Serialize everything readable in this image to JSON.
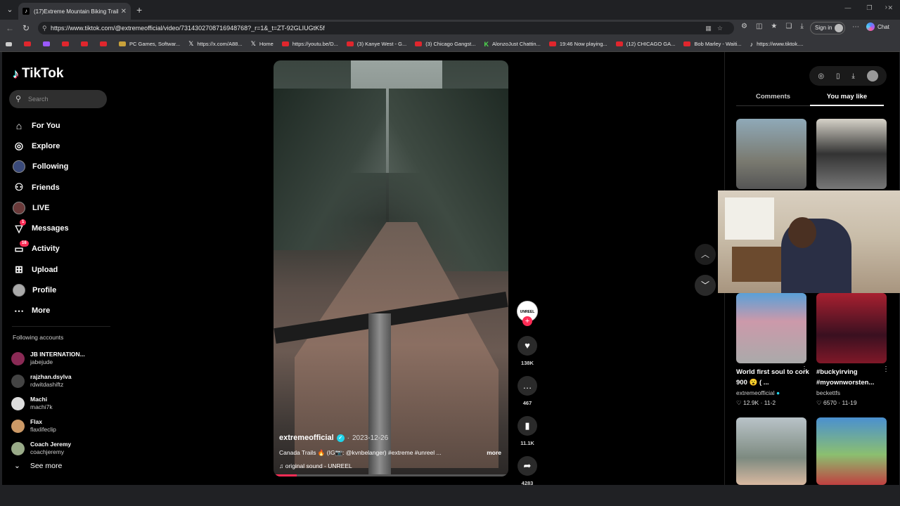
{
  "browser": {
    "tab_title": "(17)Extreme Mountain Biking Trails",
    "url": "https://www.tiktok.com/@extremeofficial/video/7314302708716948768?_r=1&_t=ZT-92GLIUGtK5f",
    "signin_label": "Sign in",
    "chat_label": "Chat",
    "bookmarks": [
      {
        "label": "",
        "icon": "yt"
      },
      {
        "label": "",
        "icon": "twitch"
      },
      {
        "label": "",
        "icon": "yt"
      },
      {
        "label": "",
        "icon": "yt"
      },
      {
        "label": "",
        "icon": "yt"
      },
      {
        "label": "PC Games, Softwar...",
        "icon": "pc"
      },
      {
        "label": "https://x.com/A88...",
        "icon": "x"
      },
      {
        "label": "Home",
        "icon": "x"
      },
      {
        "label": "https://youtu.be/D...",
        "icon": "yt"
      },
      {
        "label": "(3) Kanye West - G...",
        "icon": "yt"
      },
      {
        "label": "(3) Chicago Gangst...",
        "icon": "yt"
      },
      {
        "label": "AlonzoJust Chattin...",
        "icon": "kick"
      },
      {
        "label": "19:46 Now playing...",
        "icon": "yt"
      },
      {
        "label": "(12) CHICAGO GA...",
        "icon": "yt"
      },
      {
        "label": "Bob Marley - Waiti...",
        "icon": "yt"
      },
      {
        "label": "https://www.tiktok....",
        "icon": "tiktok"
      }
    ]
  },
  "sidebar": {
    "logo": "TikTok",
    "search_placeholder": "Search",
    "menu": [
      {
        "label": "For You",
        "icon": "home-icon"
      },
      {
        "label": "Explore",
        "icon": "compass-icon"
      },
      {
        "label": "Following",
        "icon": "avatar"
      },
      {
        "label": "Friends",
        "icon": "friends-icon"
      },
      {
        "label": "LIVE",
        "icon": "avatar"
      },
      {
        "label": "Messages",
        "icon": "send-icon",
        "badge": "1"
      },
      {
        "label": "Activity",
        "icon": "inbox-icon",
        "badge": "16"
      },
      {
        "label": "Upload",
        "icon": "plus-square-icon"
      },
      {
        "label": "Profile",
        "icon": "avatar"
      },
      {
        "label": "More",
        "icon": "ellipsis-icon"
      }
    ],
    "following_title": "Following accounts",
    "following": [
      {
        "name": "JB INTERNATION...",
        "handle": "jabejude"
      },
      {
        "name": "rajzhan.dsylva",
        "handle": "rdwitdashiftz"
      },
      {
        "name": "Machi",
        "handle": "machi7k"
      },
      {
        "name": "Flax",
        "handle": "flaxlifeclip"
      },
      {
        "name": "Coach Jeremy",
        "handle": "coachjeremy"
      }
    ],
    "see_more": "See more"
  },
  "video": {
    "username": "extremeofficial",
    "date": "2023-12-26",
    "caption": "Canada Trails 🔥 (IG📷: @kvnbelanger) #extreme #unreel ...",
    "more": "more",
    "sound": "original sound - UNREEL",
    "progress": 0.1,
    "creator_avatar_text": "UNREEL",
    "likes": "138K",
    "comments": "467",
    "saves": "11.1K",
    "shares": "4283"
  },
  "right_panel": {
    "tabs": [
      "Comments",
      "You may like"
    ],
    "active_tab": 1,
    "cards": [
      {
        "title": "",
        "author": "",
        "likes": "",
        "date": ""
      },
      {
        "title": "",
        "author": "",
        "likes": "",
        "date": ""
      },
      {
        "title": "World first soul to cork 900 😮 ( ...",
        "author": "extremeofficial",
        "likes": "12.9K",
        "date": "11-2"
      },
      {
        "title": "#buckyirving #myownworsten...",
        "author": "beckettfs",
        "likes": "6570",
        "date": "11-19"
      }
    ]
  },
  "colors": {
    "accent": "#fe2c55",
    "verified": "#20d5ec"
  }
}
